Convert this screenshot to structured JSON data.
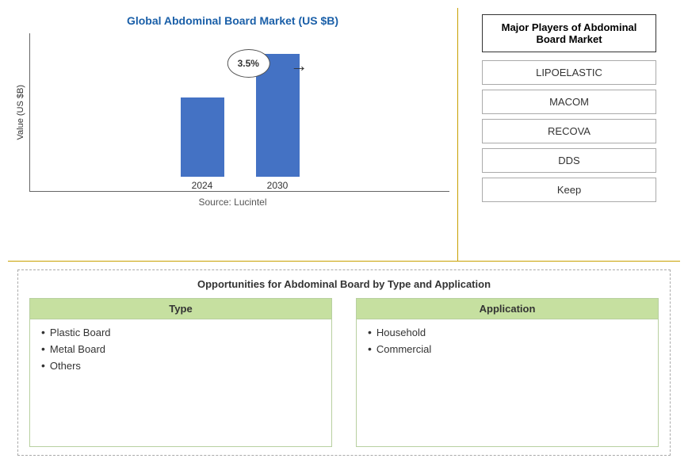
{
  "chart": {
    "title": "Global Abdominal Board Market (US $B)",
    "y_axis_label": "Value (US $B)",
    "source": "Source: Lucintel",
    "cagr_label": "3.5%",
    "bars": [
      {
        "year": "2024",
        "height": 100
      },
      {
        "year": "2030",
        "height": 155
      }
    ]
  },
  "players": {
    "title": "Major Players of Abdominal Board Market",
    "items": [
      {
        "name": "LIPOELASTIC"
      },
      {
        "name": "MACOM"
      },
      {
        "name": "RECOVA"
      },
      {
        "name": "DDS"
      },
      {
        "name": "Keep"
      }
    ]
  },
  "opportunities": {
    "title": "Opportunities for Abdominal Board by Type and Application",
    "type": {
      "header": "Type",
      "items": [
        "Plastic Board",
        "Metal Board",
        "Others"
      ]
    },
    "application": {
      "header": "Application",
      "items": [
        "Household",
        "Commercial"
      ]
    }
  }
}
